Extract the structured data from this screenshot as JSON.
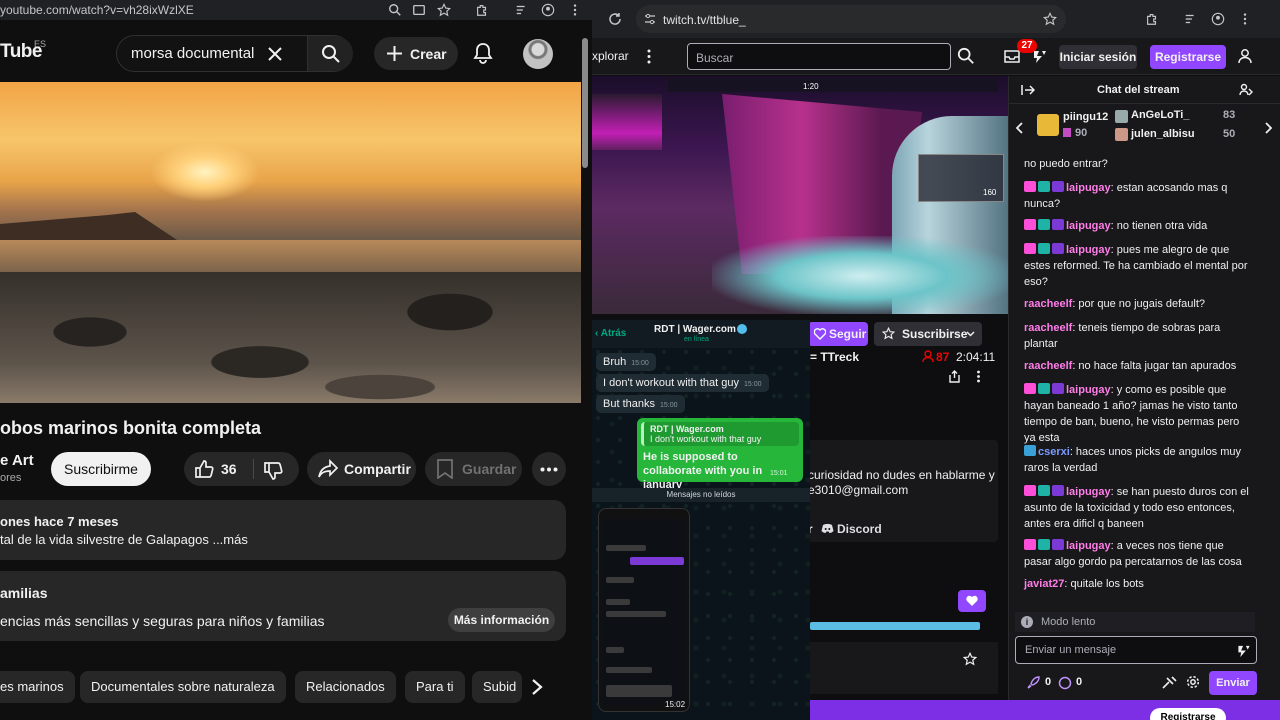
{
  "youtube": {
    "url": "youtube.com/watch?v=vh28ixWzlXE",
    "logo": "Tube",
    "logo_country": "ES",
    "search_value": "morsa documental",
    "create_label": "Crear",
    "video_title": "obos marinos bonita completa",
    "channel_name": "e Art",
    "channel_subs": "ores",
    "subscribe_label": "Suscribirme",
    "like_count": "36",
    "share_label": "Compartir",
    "save_label": "Guardar",
    "desc_meta": "ones  hace 7 meses",
    "desc_text": "tal de la vida silvestre de Galapagos ...más",
    "info_title": "amilias",
    "info_text": "encias más sencillas y seguras para niños y familias",
    "info_button": "Más información",
    "chips": [
      "es marinos",
      "Documentales sobre naturaleza",
      "Relacionados",
      "Para ti",
      "Subid"
    ]
  },
  "twitch": {
    "url": "twitch.tv/ttblue_",
    "explore": "xplorar",
    "search_placeholder": "Buscar",
    "notif_count": "27",
    "login_label": "Iniciar sesión",
    "signup_label": "Registrarse",
    "follow_label": "Seguir",
    "subscribe_label": "Suscribirse",
    "game": "= TTreck",
    "viewers": "87",
    "uptime": "2:04:11",
    "panel_line1": "curiosidad no dudes en hablarme y",
    "panel_line2": "e3010@gmail.com",
    "panel_link_left": "r",
    "discord_label": "Discord",
    "bottom_button": "Registrarse",
    "hud_score": "1:20",
    "minimap_number": "160"
  },
  "whatsapp": {
    "back": "Atrás",
    "contact": "RDT | Wager.com",
    "status": "en línea",
    "messages_in": [
      {
        "text": "Bruh",
        "time": "15:00"
      },
      {
        "text": "I don't workout with that guy",
        "time": "15:00"
      },
      {
        "text": "But thanks",
        "time": "15:00"
      }
    ],
    "quote_author": "RDT | Wager.com",
    "quote_text": "I don't workout with that guy",
    "reply_text": "He is supposed to collaborate with you in january",
    "reply_time": "15:01",
    "unread": "Mensajes no leídos",
    "time": "15:02"
  },
  "chat": {
    "title": "Chat del stream",
    "gifters": [
      {
        "name": "piingu12",
        "count": "90"
      },
      {
        "name": "AnGeLoTi_",
        "count": "83"
      },
      {
        "name": "julen_albisu",
        "count": "50"
      }
    ],
    "messages": [
      {
        "user": "",
        "text": "no puedo entrar?",
        "color": "#efeff1",
        "badges": false
      },
      {
        "user": "laipugay",
        "text": ": estan acosando mas q nunca?",
        "color": "#ff7de8",
        "badges": true
      },
      {
        "user": "laipugay",
        "text": ": no tienen otra vida",
        "color": "#ff7de8",
        "badges": true
      },
      {
        "user": "laipugay",
        "text": ": pues me alegro de que estes reformed. Te ha cambiado el mental por eso?",
        "color": "#ff7de8",
        "badges": true
      },
      {
        "user": "raacheelf",
        "text": ": por que no jugais default?",
        "color": "#ff7de8",
        "badges": false
      },
      {
        "user": "raacheelf",
        "text": ": teneis tiempo de sobras para plantar",
        "color": "#ff7de8",
        "badges": false
      },
      {
        "user": "raacheelf",
        "text": ": no hace falta jugar tan apurados",
        "color": "#ff7de8",
        "badges": false
      },
      {
        "user": "laipugay",
        "text": ": y como es posible que hayan baneado 1 año? jamas he visto tanto tiempo de ban, bueno, he visto permas pero ya esta",
        "color": "#ff7de8",
        "badges": true
      },
      {
        "user": "cserxi",
        "text": ": haces unos picks de angulos muy raros la verdad",
        "color": "#7b9bff",
        "badges": false
      },
      {
        "user": "laipugay",
        "text": ": se han puesto duros con el asunto de la toxicidad y todo eso entonces, antes era dificl q baneen",
        "color": "#ff7de8",
        "badges": true
      },
      {
        "user": "laipugay",
        "text": ": a veces nos tiene que pasar algo gordo pa percatarnos de las cosa",
        "color": "#ff7de8",
        "badges": true
      },
      {
        "user": "javiat27",
        "text": ": quitale los bots",
        "color": "#ff7de8",
        "badges": false
      }
    ],
    "slow_mode": "Modo lento",
    "input_placeholder": "Enviar un mensaje",
    "points_a": "0",
    "points_b": "0",
    "send_label": "Enviar"
  }
}
